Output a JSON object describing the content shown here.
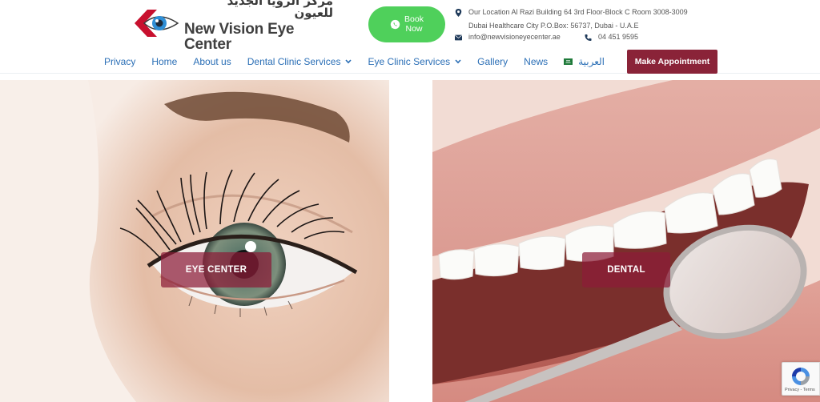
{
  "header": {
    "logo": {
      "arabic_name": "مركز الرؤيا الجديد للعيون",
      "english_name": "New Vision Eye Center"
    },
    "book_button": {
      "line1": "Book",
      "line2": "Now",
      "icon": "whatsapp-icon"
    },
    "contact": {
      "address_line1": "Our Location Al Razi Building 64 3rd Floor-Block C Room 3008-3009",
      "address_line2": "Dubai Healthcare City P.O.Box: 56737, Dubai - U.A.E",
      "email": "info@newvisioneyecenter.ae",
      "phone": "04 451 9595"
    }
  },
  "nav": {
    "items": [
      {
        "label": "Privacy"
      },
      {
        "label": "Home"
      },
      {
        "label": "About us"
      },
      {
        "label": "Dental Clinic Services",
        "dropdown": true
      },
      {
        "label": "Eye Clinic Services",
        "dropdown": true
      },
      {
        "label": "Gallery"
      },
      {
        "label": "News"
      },
      {
        "label": "العربية",
        "icon": "saudi-flag-icon"
      }
    ],
    "appointment_button": "Make Appointment"
  },
  "hero": {
    "eye_button": "EYE CENTER",
    "dental_button": "DENTAL"
  },
  "recaptcha": {
    "text": "Privacy - Terms"
  },
  "colors": {
    "nav_link": "#2b6fb6",
    "book_button": "#4fd05b",
    "appointment_button": "#8a2338",
    "overlay_button": "#8c1c38"
  }
}
